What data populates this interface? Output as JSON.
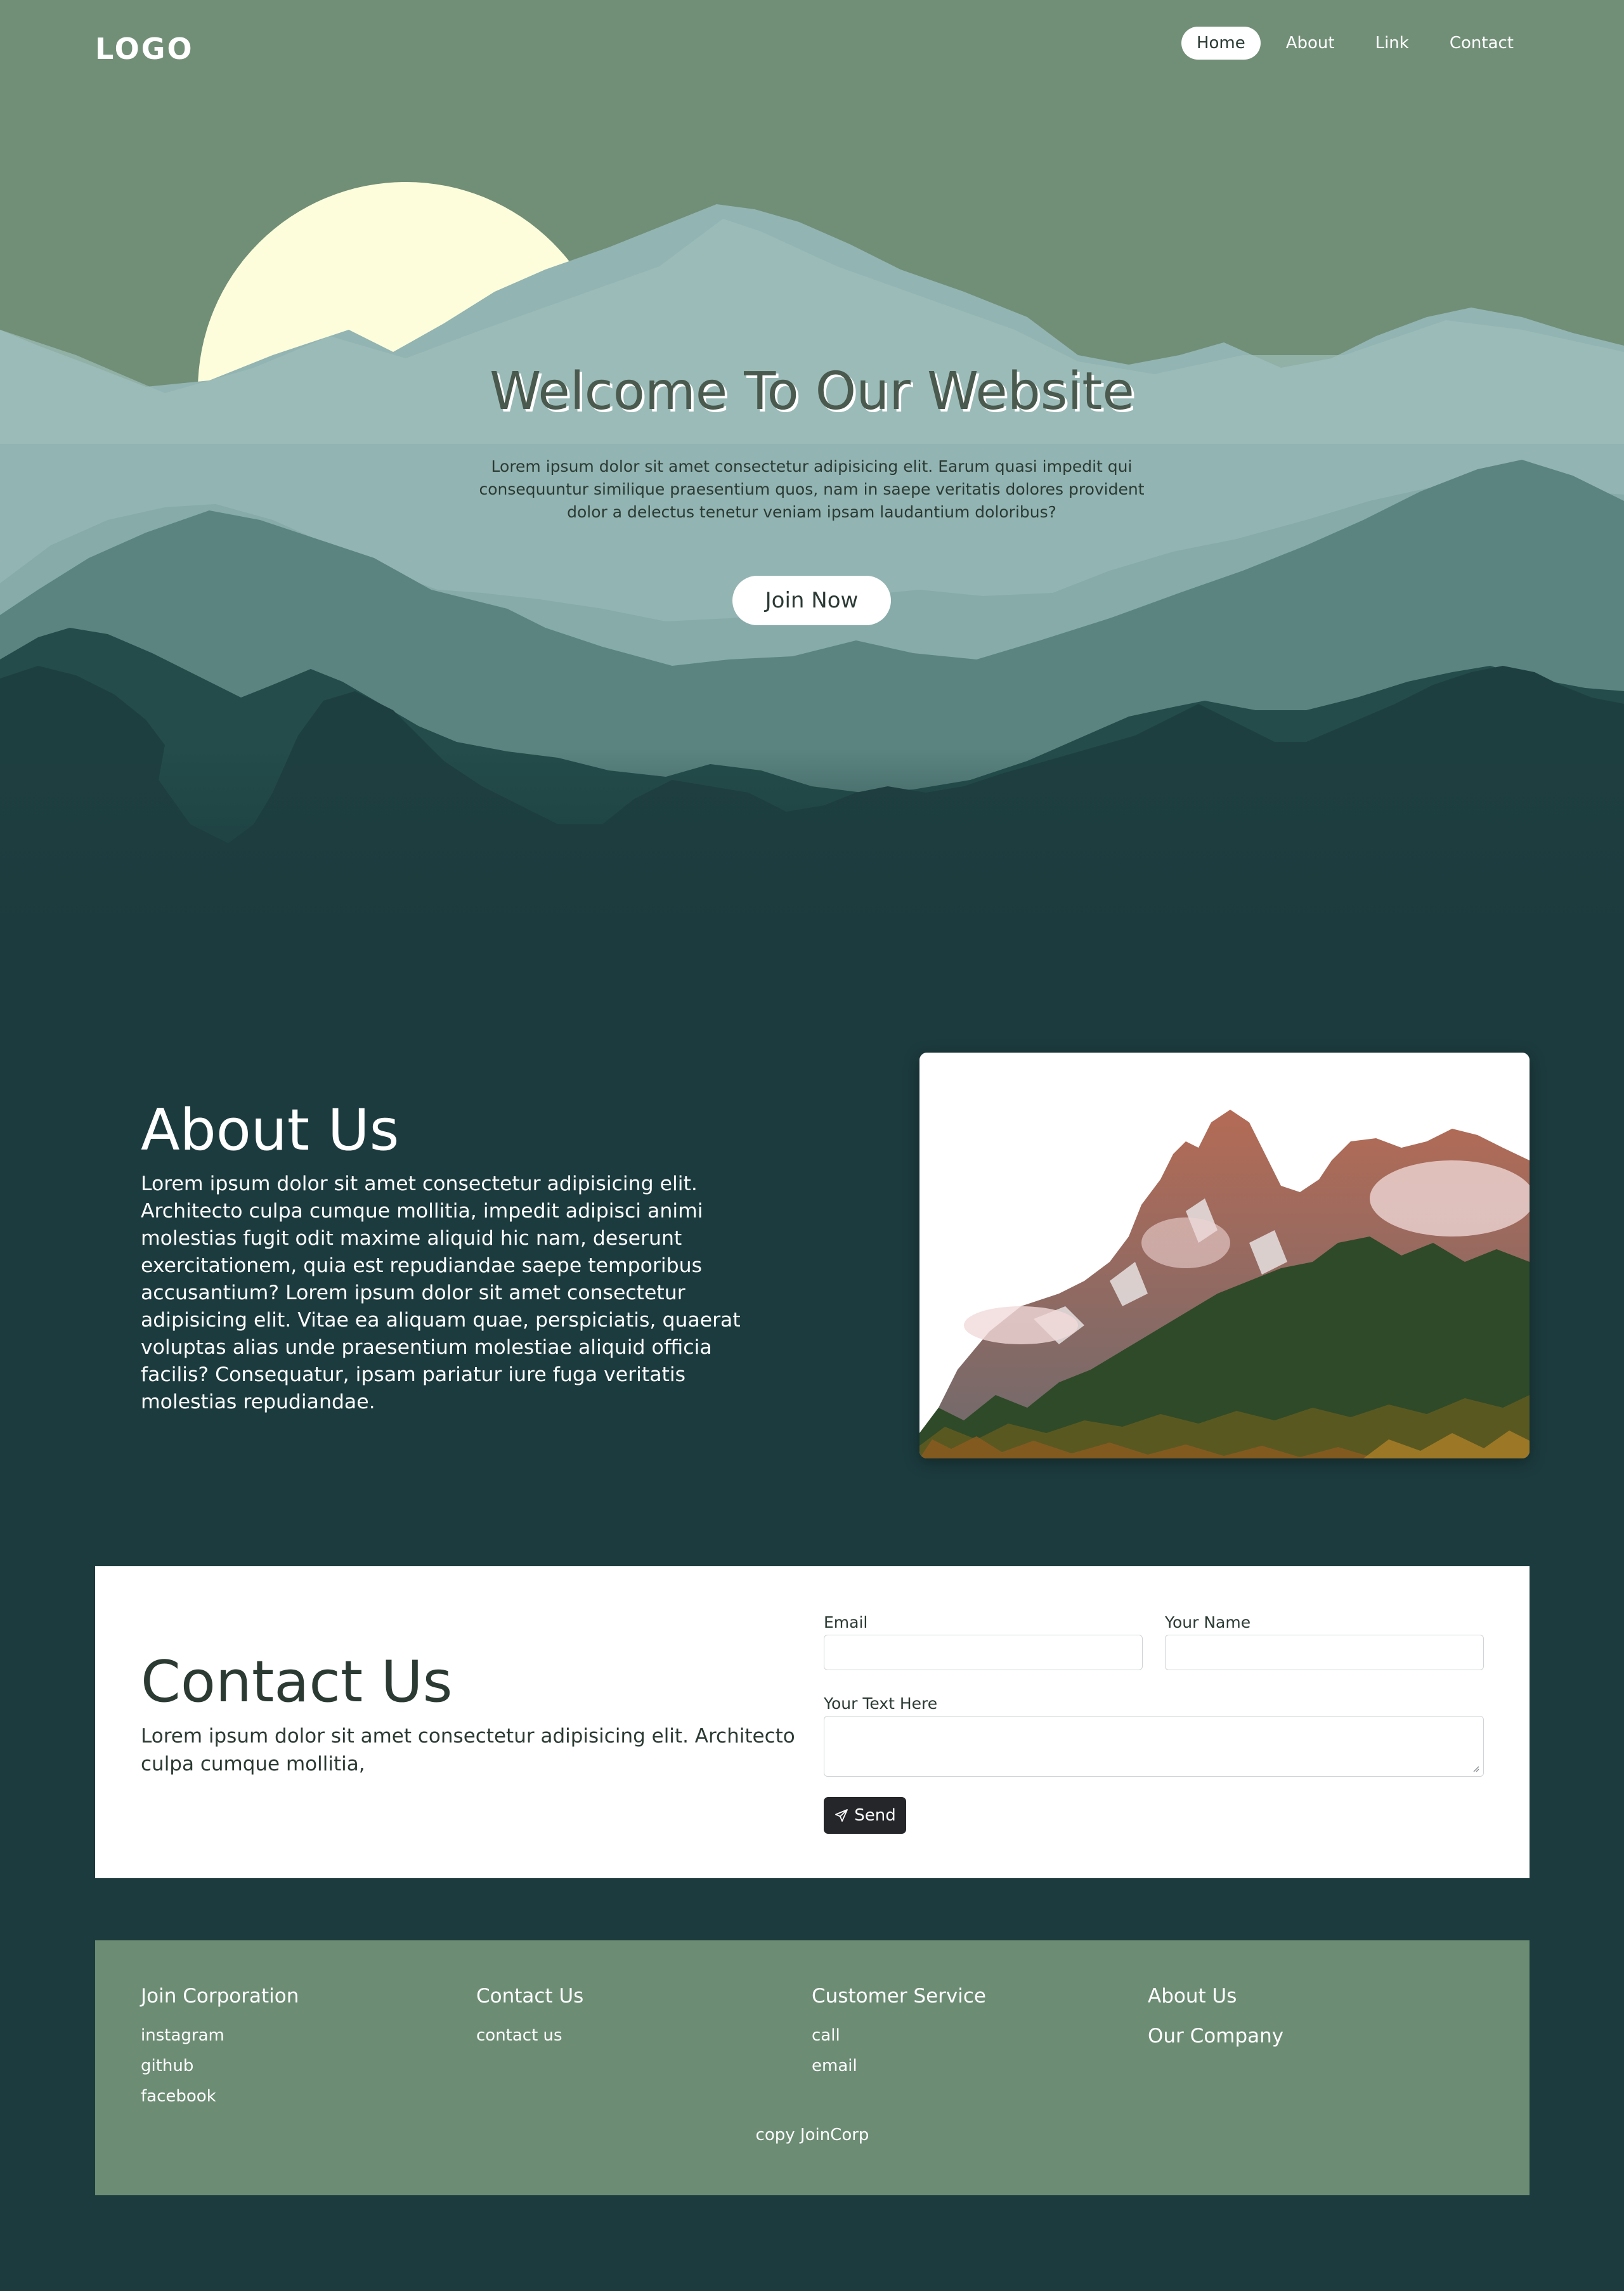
{
  "header": {
    "logo": "LOGO",
    "nav": [
      {
        "label": "Home",
        "active": true
      },
      {
        "label": "About",
        "active": false
      },
      {
        "label": "Link",
        "active": false
      },
      {
        "label": "Contact",
        "active": false
      }
    ]
  },
  "hero": {
    "title": "Welcome To Our Website",
    "text": "Lorem ipsum dolor sit amet consectetur adipisicing elit. Earum quasi impedit qui consequuntur similique praesentium quos, nam in saepe veritatis dolores provident dolor a delectus tenetur veniam ipsam laudantium doloribus?",
    "button": "Join Now"
  },
  "about": {
    "title": "About Us",
    "text": "Lorem ipsum dolor sit amet consectetur adipisicing elit. Architecto culpa cumque mollitia, impedit adipisci animi molestias fugit odit maxime aliquid hic nam, deserunt exercitationem, quia est repudiandae saepe temporibus accusantium? Lorem ipsum dolor sit amet consectetur adipisicing elit. Vitae ea aliquam quae, perspiciatis, quaerat voluptas alias unde praesentium molestiae aliquid officia facilis? Consequatur, ipsam pariatur iure fuga veritatis molestias repudiandae."
  },
  "contact": {
    "title": "Contact Us",
    "text": "Lorem ipsum dolor sit amet consectetur adipisicing elit. Architecto culpa cumque mollitia,",
    "email_label": "Email",
    "email_value": "",
    "name_label": "Your Name",
    "name_value": "",
    "message_label": "Your Text Here",
    "message_value": "",
    "send_label": "Send"
  },
  "footer": {
    "columns": [
      {
        "heading": "Join Corporation",
        "links": [
          "instagram",
          "github",
          "facebook"
        ]
      },
      {
        "heading": "Contact Us",
        "links": [
          "contact us"
        ]
      },
      {
        "heading": "Customer Service",
        "links": [
          "call",
          "email"
        ]
      },
      {
        "heading": "About Us",
        "text": "Our Company"
      }
    ],
    "copyright": "copy JoinCorp"
  },
  "colors": {
    "sky": "#718f77",
    "sun": "#fdfddc",
    "page_background": "#1c3b3e",
    "footer_background": "#6c8c74",
    "send_button": "#24262a"
  },
  "icons": {
    "send_button_icon": "paper-plane-icon"
  }
}
